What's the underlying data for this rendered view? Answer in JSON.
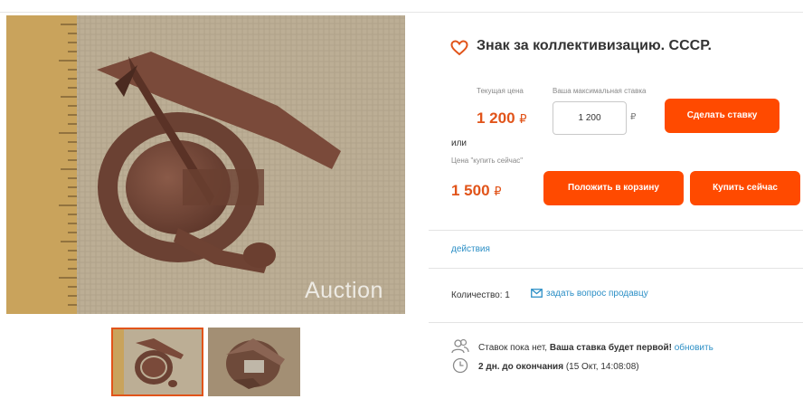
{
  "product": {
    "title": "Знак за коллективизацию. СССР.",
    "photo_watermark": "Auction"
  },
  "bid": {
    "current_price_label": "Текущая цена",
    "current_price": "1 200",
    "max_bid_label": "Ваша максимальная ставка",
    "max_bid_value": "1 200",
    "currency_symbol": "₽",
    "bid_button": "Сделать ставку"
  },
  "buy_now": {
    "or_label": "или",
    "label": "Цена \"купить сейчас\"",
    "price": "1 500",
    "cart_button": "Положить в корзину",
    "buy_button": "Купить сейчас"
  },
  "links": {
    "actions": "действия",
    "ask_seller": "задать вопрос продавцу",
    "refresh": "обновить"
  },
  "quantity": {
    "label": "Количество: 1"
  },
  "status": {
    "no_bids_text": "Ставок пока нет,",
    "first_bid_text": "Ваша ставка будет первой!",
    "time_left": "2 дн. до окончания",
    "end_date": "(15 Окт, 14:08:08)"
  },
  "icons": {
    "favorite": "heart-icon",
    "ask": "envelope-icon",
    "bidders": "people-icon",
    "timer": "clock-icon"
  },
  "colors": {
    "accent": "#ff4a00",
    "price": "#e1541a",
    "link": "#2c8fc6"
  }
}
